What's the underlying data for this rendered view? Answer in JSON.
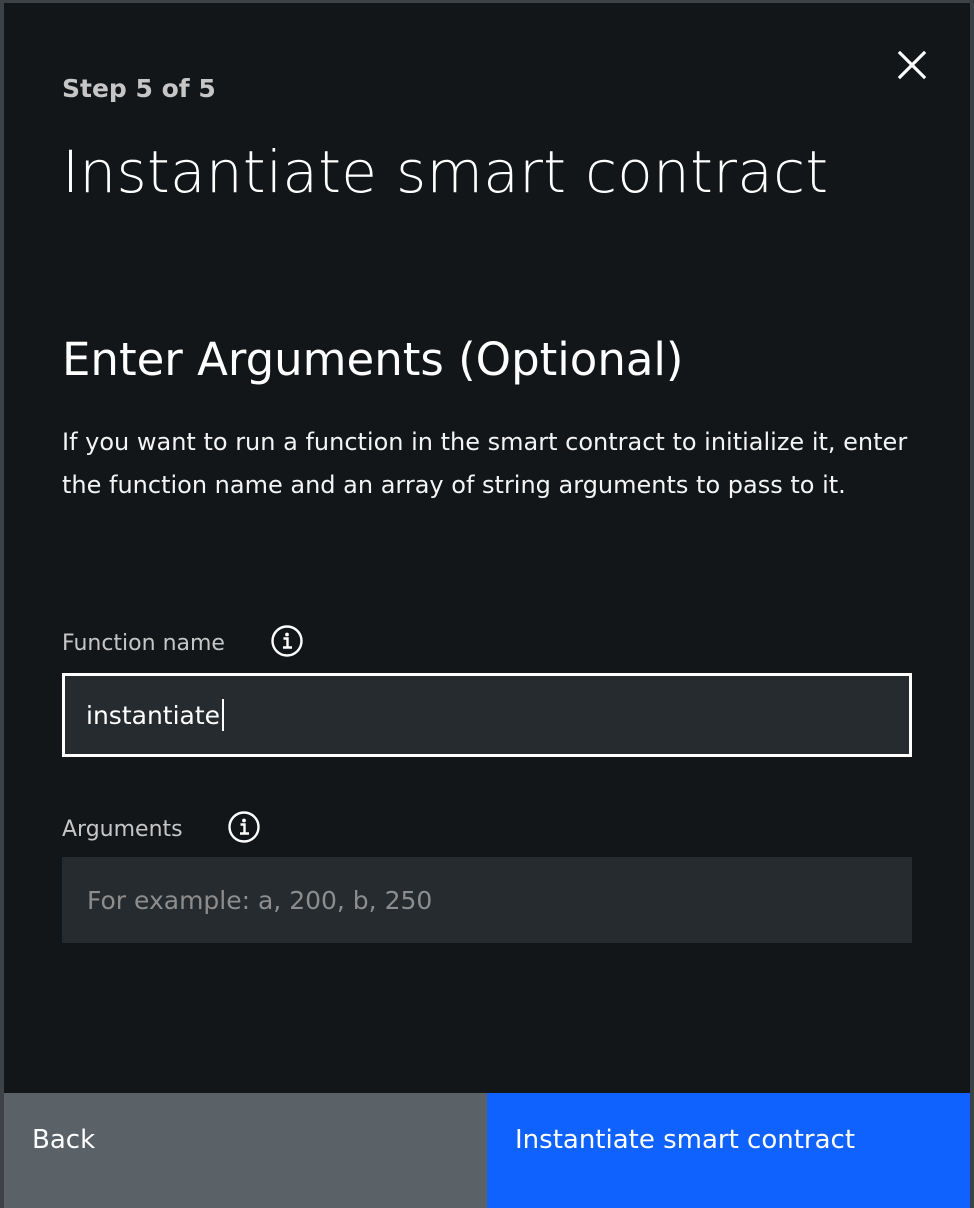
{
  "modal": {
    "step": "Step 5 of 5",
    "title": "Instantiate smart contract",
    "close_icon": "close-icon"
  },
  "section": {
    "heading": "Enter Arguments (Optional)",
    "description": "If you want to run a function in the smart contract to initialize it, enter the function name and an array of string arguments to pass to it."
  },
  "fields": {
    "function_name": {
      "label": "Function name",
      "value": "instantiate",
      "info_icon": "info-icon"
    },
    "arguments": {
      "label": "Arguments",
      "value": "",
      "placeholder": "For example: a, 200, b, 250",
      "info_icon": "info-icon"
    }
  },
  "footer": {
    "back_label": "Back",
    "primary_label": "Instantiate smart contract"
  },
  "colors": {
    "background": "#121619",
    "field_background": "#262b2f",
    "secondary_button": "#5a6268",
    "primary_button": "#0f62fe",
    "text": "#ffffff",
    "label_text": "#c6c6c6",
    "placeholder_text": "#8d8d8d"
  }
}
